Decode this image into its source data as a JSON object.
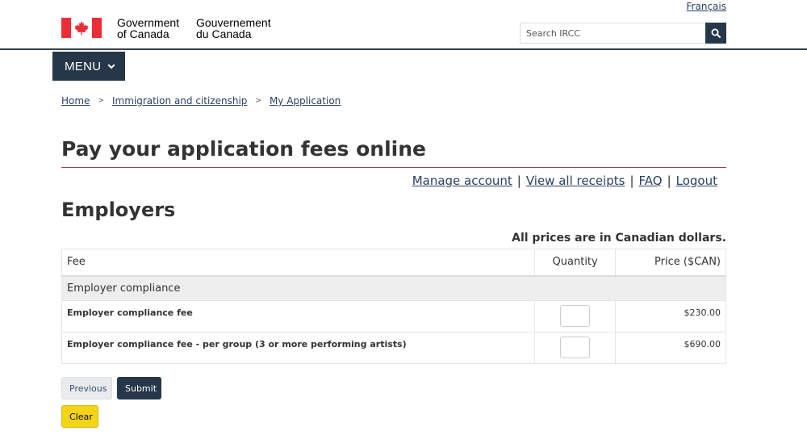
{
  "header": {
    "lang_link": "Français",
    "gov_en_line1": "Government",
    "gov_en_line2": "of Canada",
    "gov_fr_line1": "Gouvernement",
    "gov_fr_line2": "du Canada",
    "flag_icon": "canada-flag-icon",
    "search_placeholder": "Search IRCC",
    "search_icon": "search-icon"
  },
  "menu": {
    "label": "MENU",
    "icon": "chevron-down-icon"
  },
  "breadcrumb": [
    {
      "label": "Home"
    },
    {
      "label": "Immigration and citizenship"
    },
    {
      "label": "My Application"
    }
  ],
  "page_title": "Pay your application fees online",
  "account_links": {
    "manage": "Manage account",
    "receipts": "View all receipts",
    "faq": "FAQ",
    "logout": "Logout",
    "separator": "|"
  },
  "section_title": "Employers",
  "price_note": "All prices are in Canadian dollars.",
  "table": {
    "headers": {
      "fee": "Fee",
      "quantity": "Quantity",
      "price": "Price ($CAN)"
    },
    "group": "Employer compliance",
    "rows": [
      {
        "fee": "Employer compliance fee",
        "quantity": "",
        "price": "$230.00"
      },
      {
        "fee": "Employer compliance fee - per group (3 or more performing artists)",
        "quantity": "",
        "price": "$690.00"
      }
    ]
  },
  "buttons": {
    "previous": "Previous",
    "submit": "Submit",
    "clear": "Clear"
  },
  "colors": {
    "brand_dark": "#26374a",
    "link": "#284162",
    "flag_red": "#eb2d37",
    "title_rule": "#af3c43",
    "clear_yellow": "#f5d418"
  }
}
